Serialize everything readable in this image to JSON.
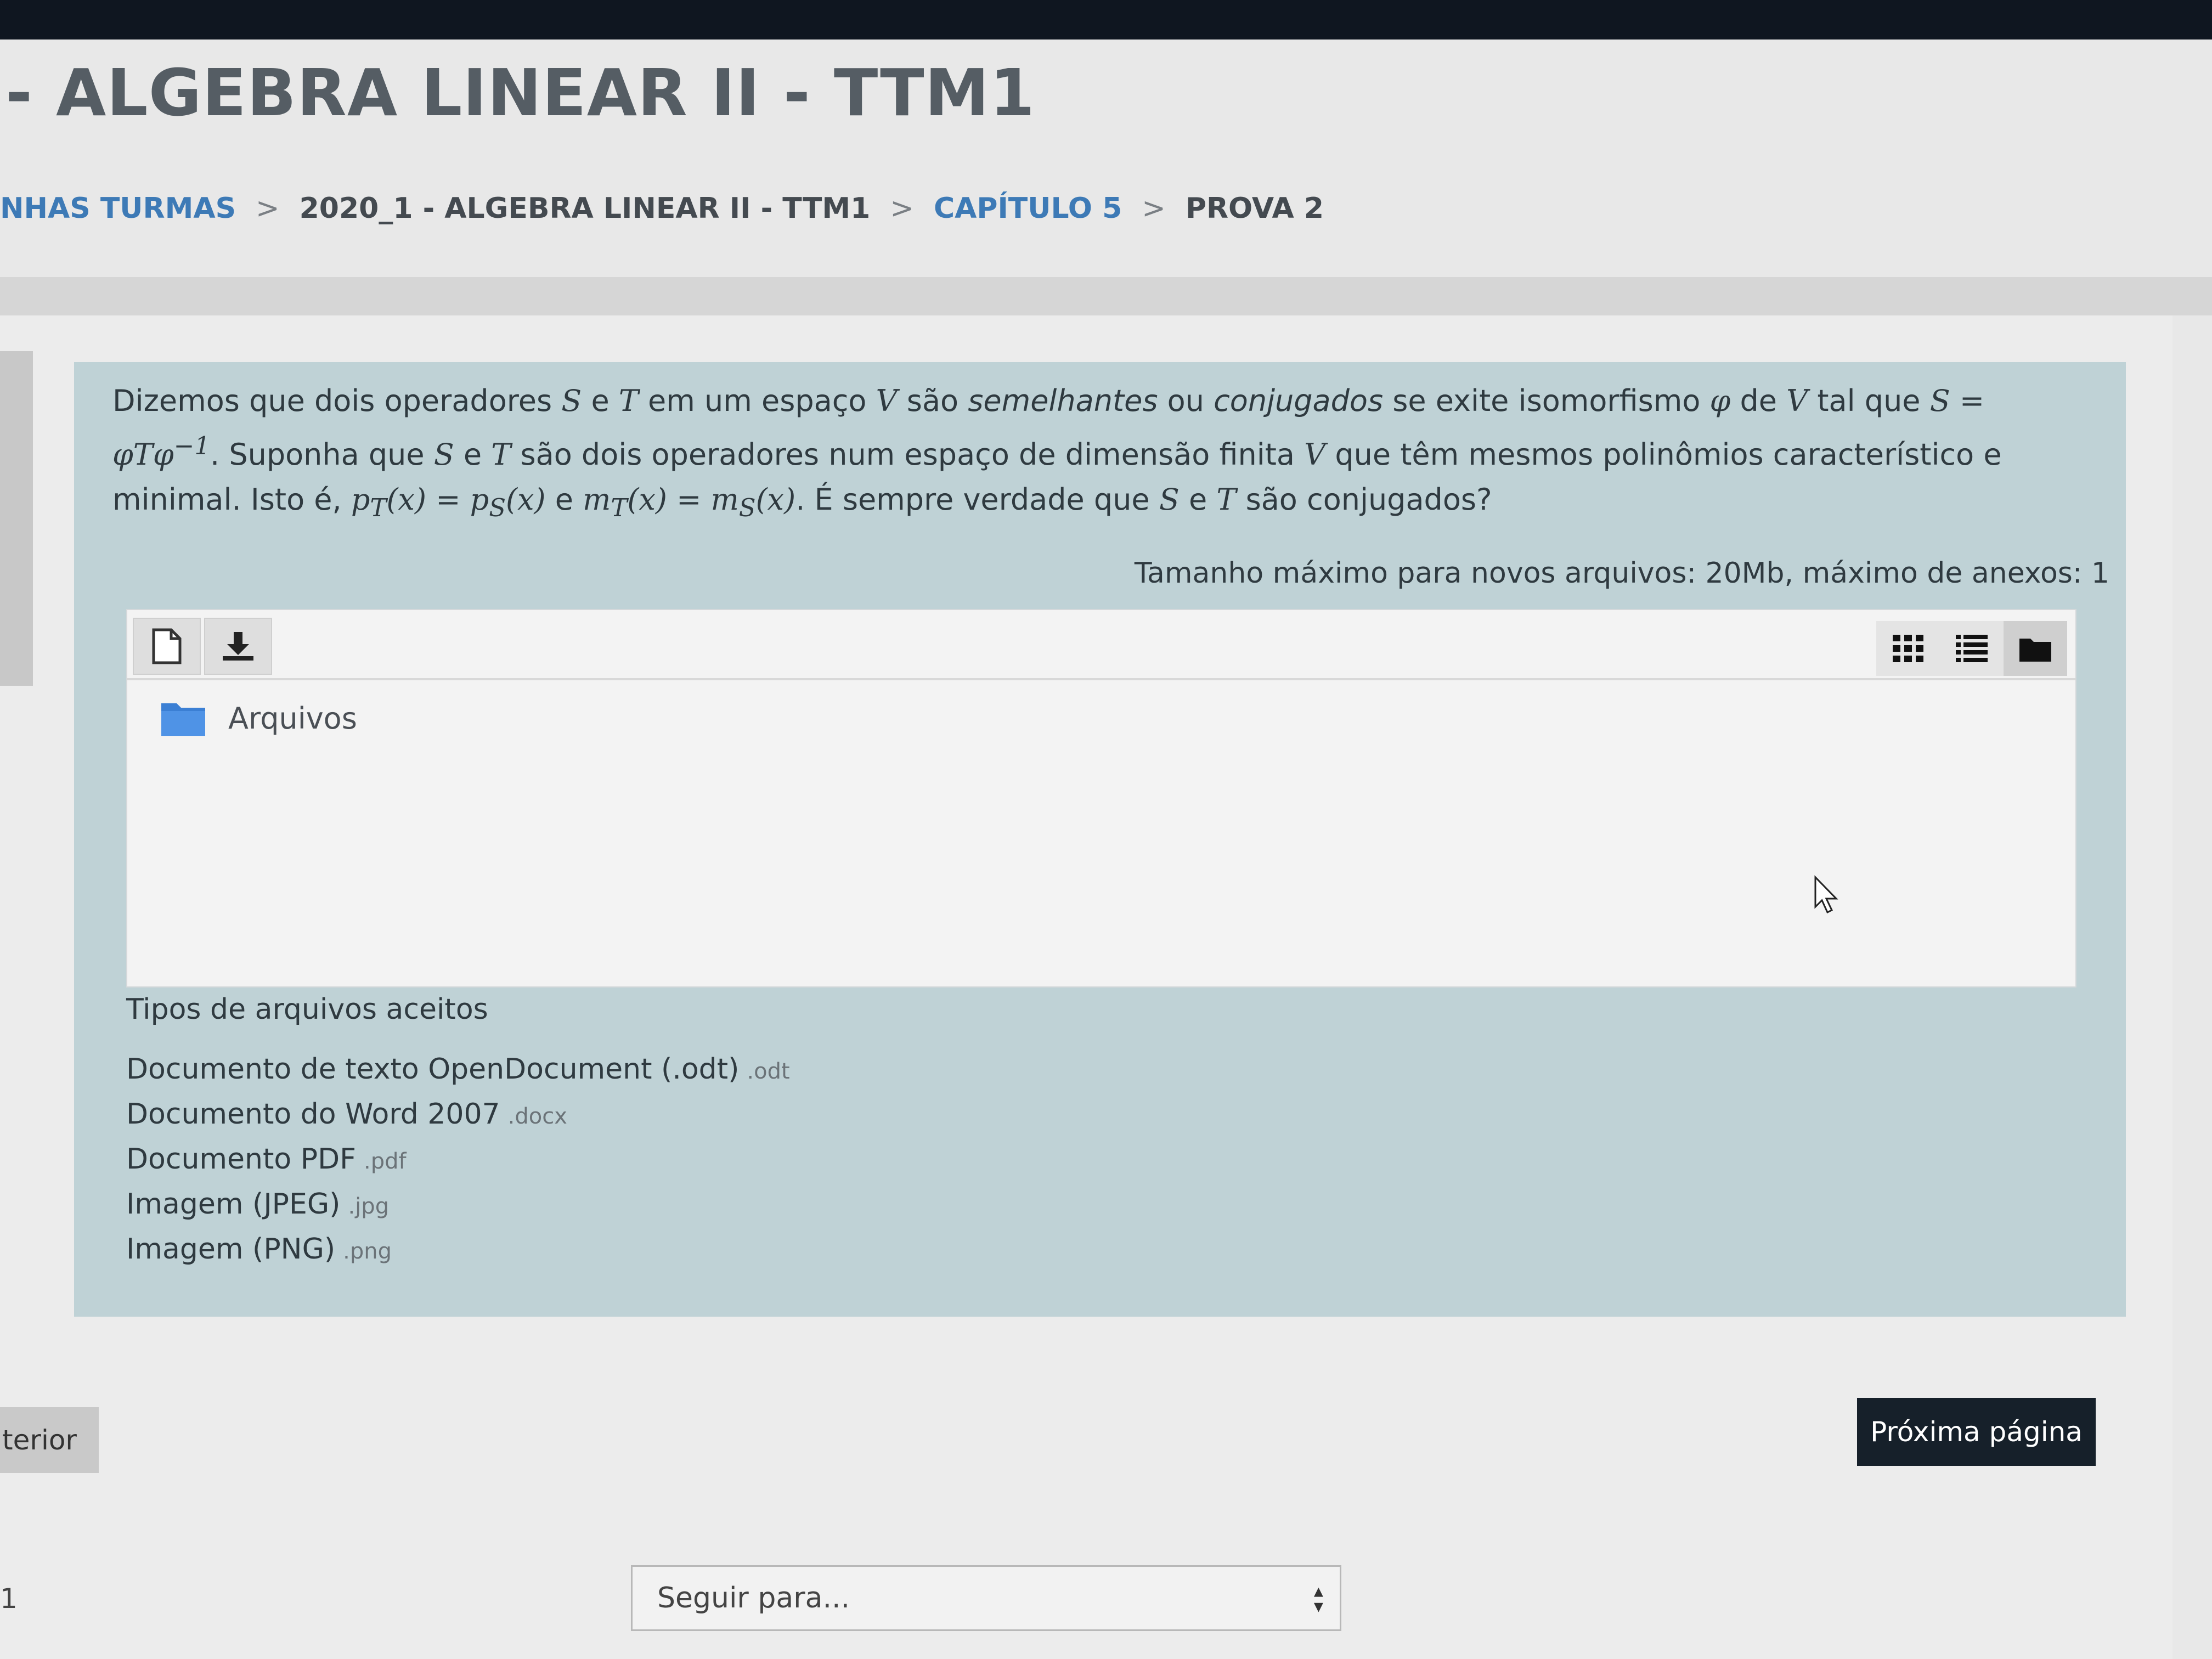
{
  "header": {
    "course_title": "- ALGEBRA LINEAR II - TTM1",
    "breadcrumb": [
      {
        "label": "NHAS TURMAS"
      },
      {
        "label": "2020_1 - ALGEBRA LINEAR II - TTM1"
      },
      {
        "label": "CAPÍTULO 5"
      },
      {
        "label": "PROVA 2"
      }
    ],
    "breadcrumb_separator": ">"
  },
  "question": {
    "t1": "Dizemos que dois operadores ",
    "S": "S",
    "e": " e ",
    "T": "T",
    "t2": " em um espaço ",
    "V": "V",
    "t3": " são ",
    "semelhantes": "semelhantes",
    "ou": " ou ",
    "conjugados": "conjugados",
    "t4": " se exite isomorfismo ",
    "phi": "φ",
    "de": " de ",
    "t5": " tal que ",
    "eq1": "S = φTφ",
    "sup": "−1",
    "t6": ". Suponha que ",
    "t7": " são dois operadores num espaço de dimensão finita ",
    "t8": " que têm mesmos polinômios característico e minimal. Isto é, ",
    "eq2": "p",
    "eq2_sub1": "T",
    "eq2_mid": "(x) = p",
    "eq2_sub2": "S",
    "eq2_end": "(x)",
    "e2": " e ",
    "eq3": "m",
    "eq3_sub1": "T",
    "eq3_mid": "(x) = m",
    "eq3_sub2": "S",
    "eq3_end": "(x)",
    "t9": ". É sempre verdade que ",
    "t10": " são conjugados?"
  },
  "filepicker": {
    "max_size_info": "Tamanho máximo para novos arquivos: 20Mb, máximo de anexos: 1",
    "folder_label": "Arquivos",
    "add_file_icon": "file-icon",
    "download_icon": "download-icon",
    "view_icons": [
      "grid-view-icon",
      "list-view-icon",
      "folder-view-icon"
    ]
  },
  "accepted": {
    "title": "Tipos de arquivos aceitos",
    "items": [
      {
        "name": "Documento de texto OpenDocument (.odt)",
        "ext": ".odt"
      },
      {
        "name": "Documento do Word 2007",
        "ext": ".docx"
      },
      {
        "name": "Documento PDF",
        "ext": ".pdf"
      },
      {
        "name": "Imagem (JPEG)",
        "ext": ".jpg"
      },
      {
        "name": "Imagem (PNG)",
        "ext": ".png"
      }
    ]
  },
  "nav": {
    "prev_label": "terior",
    "next_label": "Próxima página",
    "page_number": "1",
    "jump_label": "Seguir para..."
  },
  "colors": {
    "question_bg": "#bfd2d6",
    "link": "#3d7ab6",
    "primary_button": "#16202a",
    "folder": "#3b7fd4"
  }
}
